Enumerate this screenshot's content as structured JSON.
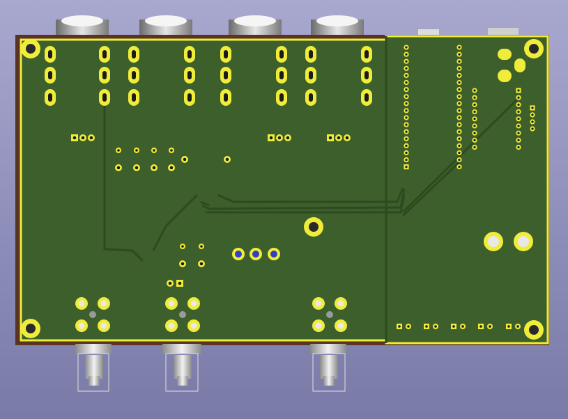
{
  "scene": {
    "view": "3d-viewer-pcb-bottom",
    "colors": {
      "background_top": "#a8a8cf",
      "background_bottom": "#7a7aa8",
      "board_edge": "#5a3422",
      "soldermask": "#3c5f2b",
      "trace": "#2d4a20",
      "copper_pad": "#f0ec3a",
      "pad_hole": "#1a1a1a",
      "connector_metal": "#bfbfbf",
      "via_blue": "#3040c0"
    },
    "connectors_top": [
      "jack",
      "jack",
      "jack",
      "jack"
    ],
    "bnc_connectors_bottom": [
      "bnc",
      "bnc",
      "bnc"
    ]
  }
}
